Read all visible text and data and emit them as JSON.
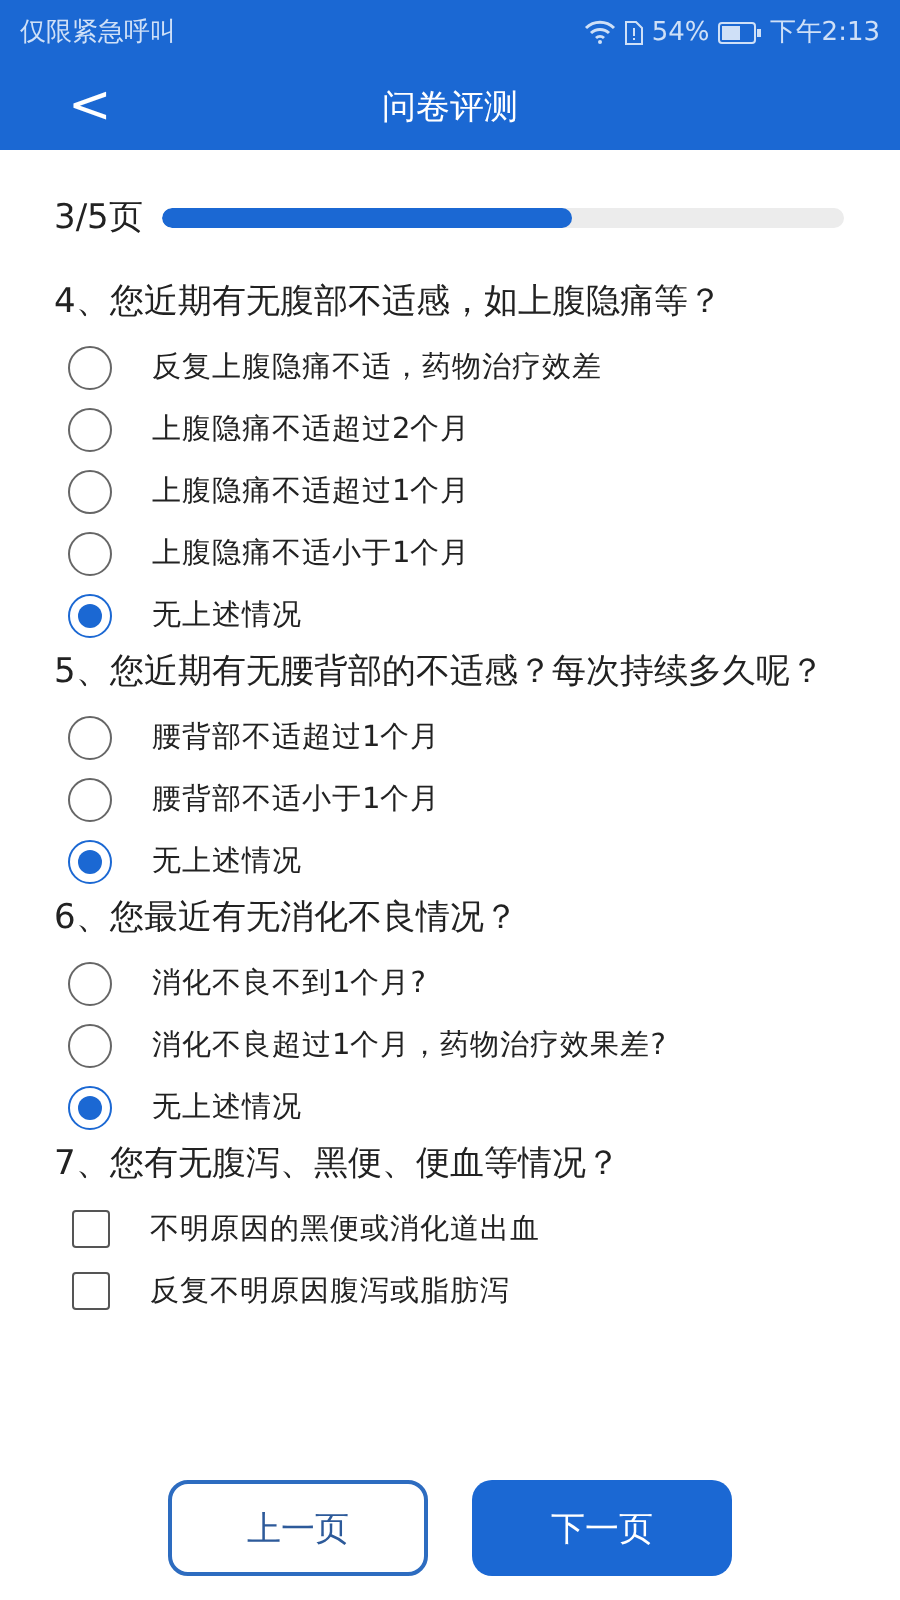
{
  "status_bar": {
    "carrier": "仅限紧急呼叫",
    "battery": "54%",
    "time": "下午2:13"
  },
  "header": {
    "back": "<",
    "title": "问卷评测"
  },
  "progress": {
    "label": "3/5页",
    "level": 0.6
  },
  "questions": [
    {
      "title": "4、您近期有无腹部不适感，如上腹隐痛等？",
      "kind": "radio",
      "options": [
        {
          "label": "反复上腹隐痛不适，药物治疗效差",
          "selected": false
        },
        {
          "label": "上腹隐痛不适超过2个月",
          "selected": false
        },
        {
          "label": "上腹隐痛不适超过1个月",
          "selected": false
        },
        {
          "label": "上腹隐痛不适小于1个月",
          "selected": false
        },
        {
          "label": "无上述情况",
          "selected": true
        }
      ]
    },
    {
      "title": "5、您近期有无腰背部的不适感？每次持续多久呢？",
      "kind": "radio",
      "options": [
        {
          "label": "腰背部不适超过1个月",
          "selected": false
        },
        {
          "label": "腰背部不适小于1个月",
          "selected": false
        },
        {
          "label": "无上述情况",
          "selected": true
        }
      ]
    },
    {
      "title": "6、您最近有无消化不良情况？",
      "kind": "radio",
      "options": [
        {
          "label": "消化不良不到1个月?",
          "selected": false
        },
        {
          "label": "消化不良超过1个月，药物治疗效果差?",
          "selected": false
        },
        {
          "label": "无上述情况",
          "selected": true
        }
      ]
    },
    {
      "title": "7、您有无腹泻、黑便、便血等情况？",
      "kind": "checkbox",
      "options": [
        {
          "label": "不明原因的黑便或消化道出血",
          "checked": false
        },
        {
          "label": "反复不明原因腹泻或脂肪泻",
          "checked": false
        }
      ]
    }
  ],
  "buttons": {
    "previous": "上一页",
    "next": "下一页"
  }
}
